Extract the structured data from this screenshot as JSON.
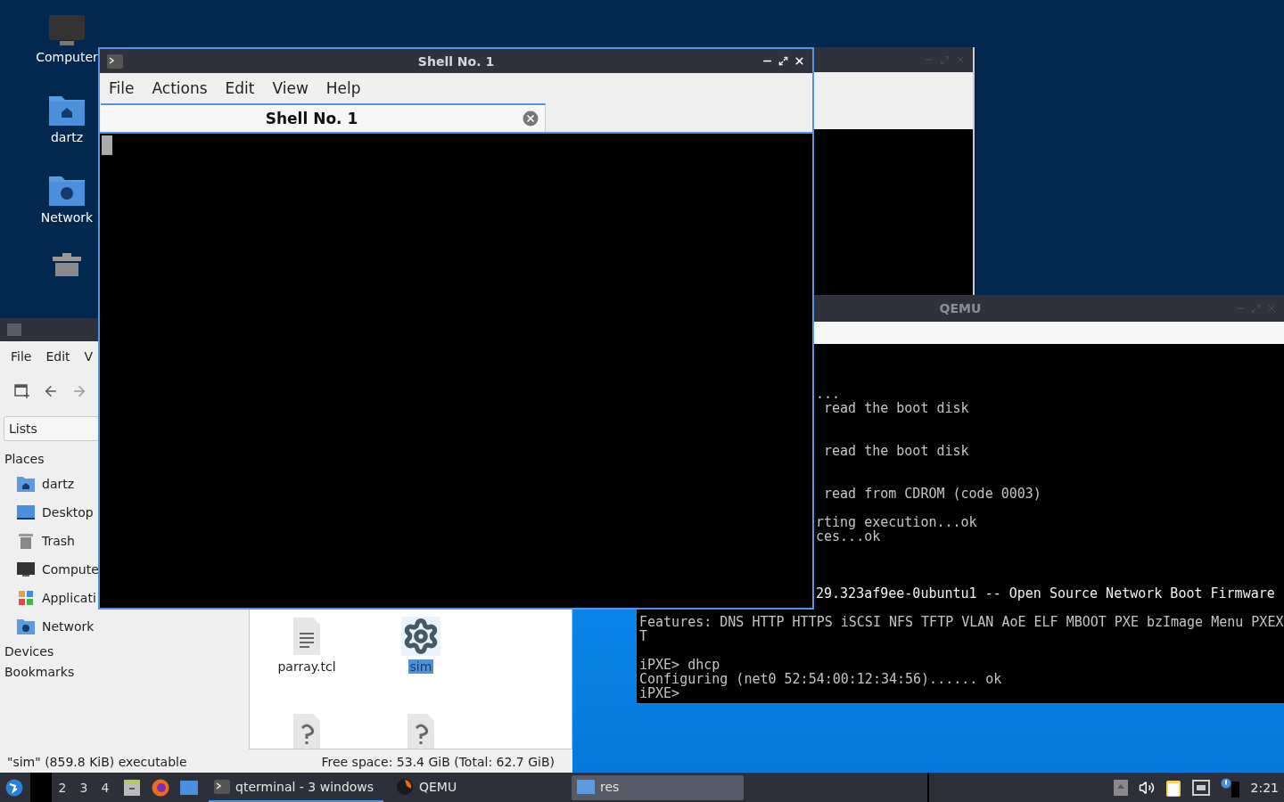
{
  "desktop_icons": [
    {
      "label": "Computer",
      "kind": "computer"
    },
    {
      "label": "dartz",
      "kind": "home"
    },
    {
      "label": "Network",
      "kind": "network"
    },
    {
      "kind": "trash"
    }
  ],
  "qemu_window": {
    "title": "QEMU",
    "console_lines": [
      {
        "kind": "blank"
      },
      {
        "kind": "blank"
      },
      {
        "kind": "blank"
      },
      {
        "kind": "partial",
        "text": "..."
      },
      {
        "kind": "partial",
        "text": " read the boot disk"
      },
      {
        "kind": "blank"
      },
      {
        "kind": "blank"
      },
      {
        "kind": "partial",
        "text": " read the boot disk"
      },
      {
        "kind": "blank"
      },
      {
        "kind": "blank"
      },
      {
        "kind": "partial",
        "text": " read from CDROM (code 0003)"
      },
      {
        "kind": "blank"
      },
      {
        "kind": "partial",
        "text": "rting execution...ok"
      },
      {
        "kind": "partial",
        "text": "ces...ok"
      },
      {
        "kind": "blank"
      },
      {
        "kind": "blank"
      },
      {
        "kind": "blank"
      },
      {
        "kind": "partial",
        "text": "29.323af9ee-0ubuntu1 -- Open Source Network Boot Firmware",
        "bright": true
      },
      {
        "kind": "blank"
      },
      {
        "kind": "full",
        "text": "Features: DNS HTTP HTTPS iSCSI NFS TFTP VLAN AoE ELF MBOOT PXE bzImage Menu PXEX"
      },
      {
        "kind": "full",
        "text": "T"
      },
      {
        "kind": "blank"
      },
      {
        "kind": "full",
        "text": "iPXE> dhcp"
      },
      {
        "kind": "full",
        "text": "Configuring (net0 52:54:00:12:34:56)...... ok"
      },
      {
        "kind": "full",
        "text": "iPXE>"
      }
    ]
  },
  "file_manager": {
    "menu": [
      "File",
      "Edit",
      "V"
    ],
    "view_mode": "Lists",
    "places_heading": "Places",
    "places": [
      {
        "label": "dartz",
        "kind": "home"
      },
      {
        "label": "Desktop",
        "kind": "desktop"
      },
      {
        "label": "Trash",
        "kind": "trash"
      },
      {
        "label": "Compute",
        "kind": "computer"
      },
      {
        "label": "Applicati",
        "kind": "applications"
      },
      {
        "label": "Network",
        "kind": "network"
      }
    ],
    "sections": [
      "Devices",
      "Bookmarks"
    ],
    "files": [
      {
        "name": "parray.tcl",
        "kind": "text",
        "selected": false
      },
      {
        "name": "sim",
        "kind": "executable",
        "selected": true
      },
      {
        "kind": "unknown",
        "selected": false
      },
      {
        "kind": "unknown",
        "selected": false
      }
    ],
    "status_left": "\"sim\" (859.8 KiB) executable",
    "status_right": "Free space: 53.4 GiB (Total: 62.7 GiB)"
  },
  "shell_window": {
    "title": "Shell No. 1",
    "menu": [
      "File",
      "Actions",
      "Edit",
      "View",
      "Help"
    ],
    "tabs": [
      {
        "label": "Shell No. 1",
        "selected": true
      }
    ]
  },
  "taskbar": {
    "workspaces": [
      {
        "selected": true
      },
      {
        "label": "2",
        "selected": false
      },
      {
        "label": "3",
        "selected": false
      },
      {
        "label": "4",
        "selected": false
      }
    ],
    "tasks": [
      {
        "label": "qterminal - 3 windows",
        "kind": "terminal",
        "selected": true
      },
      {
        "label": "QEMU",
        "kind": "qemu",
        "selected": false
      },
      {
        "label": "res",
        "kind": "folder",
        "selected": false,
        "hovered": true
      }
    ],
    "clock": "2:21"
  }
}
